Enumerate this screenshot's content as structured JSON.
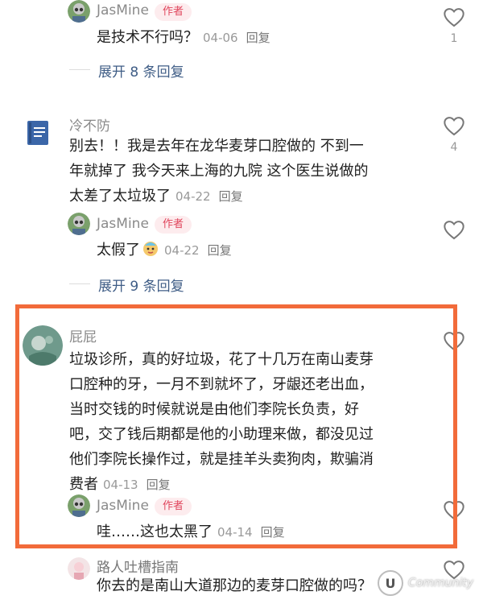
{
  "comments": [
    {
      "user": "JasMine",
      "badge": "作者",
      "text": "是技术不行吗？",
      "date": "04-06",
      "reply_label": "回复",
      "likes": "1"
    },
    {
      "expand_label": "展开 8 条回复"
    },
    {
      "user": "冷不防",
      "lines": [
        "别去！！我是去年在龙华麦芽口腔做的 不到一",
        "年就掉了 我今天来上海的九院 这个医生说做的",
        "太差了太垃圾了"
      ],
      "date": "04-22",
      "reply_label": "回复",
      "likes": "4"
    },
    {
      "user": "JasMine",
      "badge": "作者",
      "text": "太假了",
      "date": "04-22",
      "reply_label": "回复"
    },
    {
      "expand_label": "展开 9 条回复"
    },
    {
      "user": "屁屁",
      "lines": [
        "垃圾诊所，真的好垃圾，花了十几万在南山麦芽",
        "口腔种的牙，一月不到就坏了，牙龈还老出血，",
        "当时交钱的时候就说是由他们李院长负责，好",
        "吧，交了钱后期都是他的小助理来做，都没见过",
        "他们李院长操作过，就是挂羊头卖狗肉，欺骗消",
        "费者"
      ],
      "date": "04-13",
      "reply_label": "回复"
    },
    {
      "user": "JasMine",
      "badge": "作者",
      "text": "哇……这也太黑了",
      "date": "04-14",
      "reply_label": "回复"
    },
    {
      "user": "路人吐槽指南",
      "text": "你去的是南山大道那边的麦芽口腔做的吗？"
    }
  ],
  "watermark": {
    "logo": "U",
    "text": "Community"
  },
  "colors": {
    "highlight_border": "#f26b3a",
    "author_badge": "#e0455c",
    "expand_link": "#3f5d86"
  }
}
